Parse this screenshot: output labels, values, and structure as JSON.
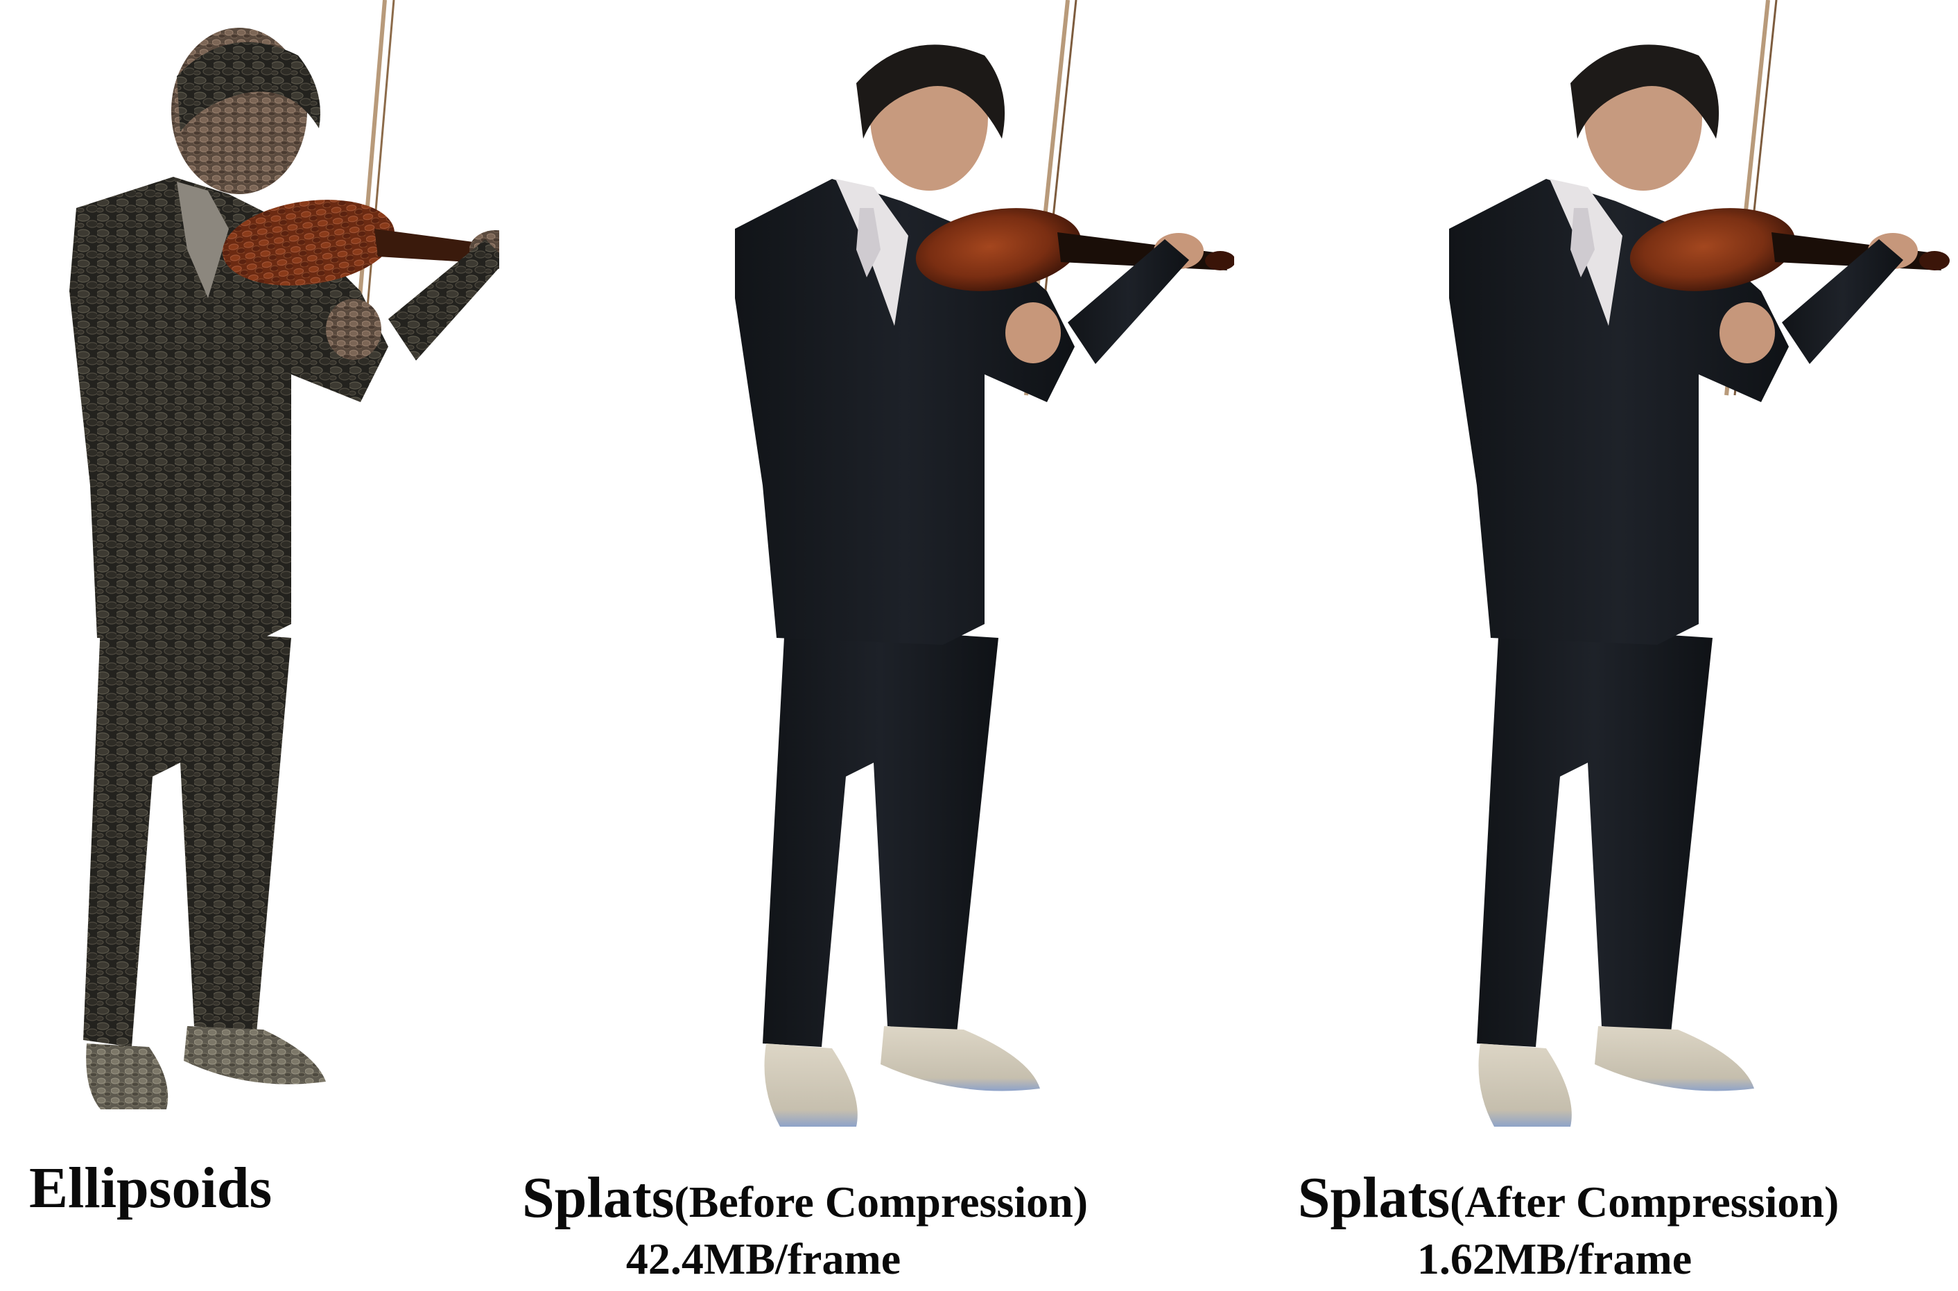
{
  "captions": {
    "ellipsoids": "Ellipsoids",
    "before": {
      "main": "Splats",
      "sub": "(Before Compression)",
      "size": "42.4MB/frame"
    },
    "after": {
      "main": "Splats",
      "sub": "(After Compression)",
      "size": "1.62MB/frame"
    }
  },
  "colors": {
    "background": "#ffffff",
    "suit": "#15181d",
    "suit_highlight": "#232830",
    "violin": "#7a2e12",
    "violin_dark": "#4a1808",
    "skin": "#c79a7e",
    "hair": "#1c1917",
    "shoe": "#d7d0bf",
    "shirt": "#e6e3e5",
    "ellipsoid_texture": "#3a3730"
  },
  "icons": {
    "panel_1": "ellipsoid-violinist-render",
    "panel_2": "splat-violinist-before-render",
    "panel_3": "splat-violinist-after-render"
  }
}
